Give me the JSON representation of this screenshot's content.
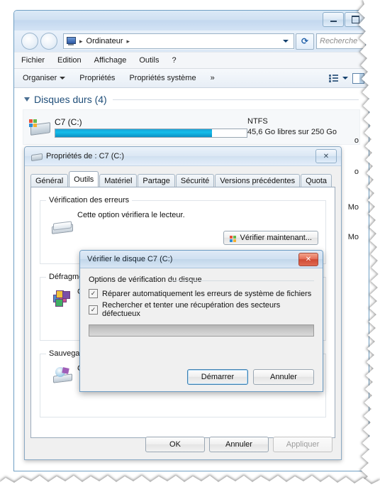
{
  "explorer": {
    "address": {
      "crumb": "Ordinateur",
      "icon": "computer-icon"
    },
    "search_placeholder": "Recherche",
    "menu": [
      "Fichier",
      "Edition",
      "Affichage",
      "Outils",
      "?"
    ],
    "toolbar": {
      "organize": "Organiser",
      "properties": "Propriétés",
      "system_properties": "Propriétés système",
      "overflow": "»"
    },
    "group": {
      "title": "Disques durs (4)"
    },
    "drive": {
      "name": "C7 (C:)",
      "filesystem": "NTFS",
      "space": "45,6 Go libres sur 250 Go",
      "used_percent": 82
    },
    "ghost_labels": [
      "o",
      "o",
      "Mo",
      "Mo"
    ]
  },
  "properties_dialog": {
    "title": "Propriétés de : C7 (C:)",
    "close": "✕",
    "tabs": [
      {
        "label": "Général",
        "active": false
      },
      {
        "label": "Outils",
        "active": true
      },
      {
        "label": "Matériel",
        "active": false
      },
      {
        "label": "Partage",
        "active": false
      },
      {
        "label": "Sécurité",
        "active": false
      },
      {
        "label": "Versions précédentes",
        "active": false
      },
      {
        "label": "Quota",
        "active": false
      }
    ],
    "error_check": {
      "legend": "Vérification des erreurs",
      "text": "Cette option vérifiera le lecteur.",
      "button": "Vérifier maintenant..."
    },
    "defrag": {
      "legend": "Défragme",
      "text": "C"
    },
    "backup": {
      "legend": "Sauvegar",
      "text": "C"
    },
    "footer": {
      "ok": "OK",
      "cancel": "Annuler",
      "apply": "Appliquer",
      "apply_disabled": true
    }
  },
  "check_disk_dialog": {
    "title": "Vérifier le disque C7 (C:)",
    "close": "✕",
    "legend": "Options de vérification du disque",
    "options": [
      {
        "label": "Réparer automatiquement les erreurs de système de fichiers",
        "checked": true
      },
      {
        "label": "Rechercher et tenter une récupération des secteurs défectueux",
        "checked": true
      }
    ],
    "progress_percent": 0,
    "start": "Démarrer",
    "cancel": "Annuler"
  },
  "colors": {
    "accent": "#1aa3d8",
    "title_blue": "#1f4e79",
    "close_red": "#cf4a34",
    "default_button_border": "#3c7fb1"
  }
}
